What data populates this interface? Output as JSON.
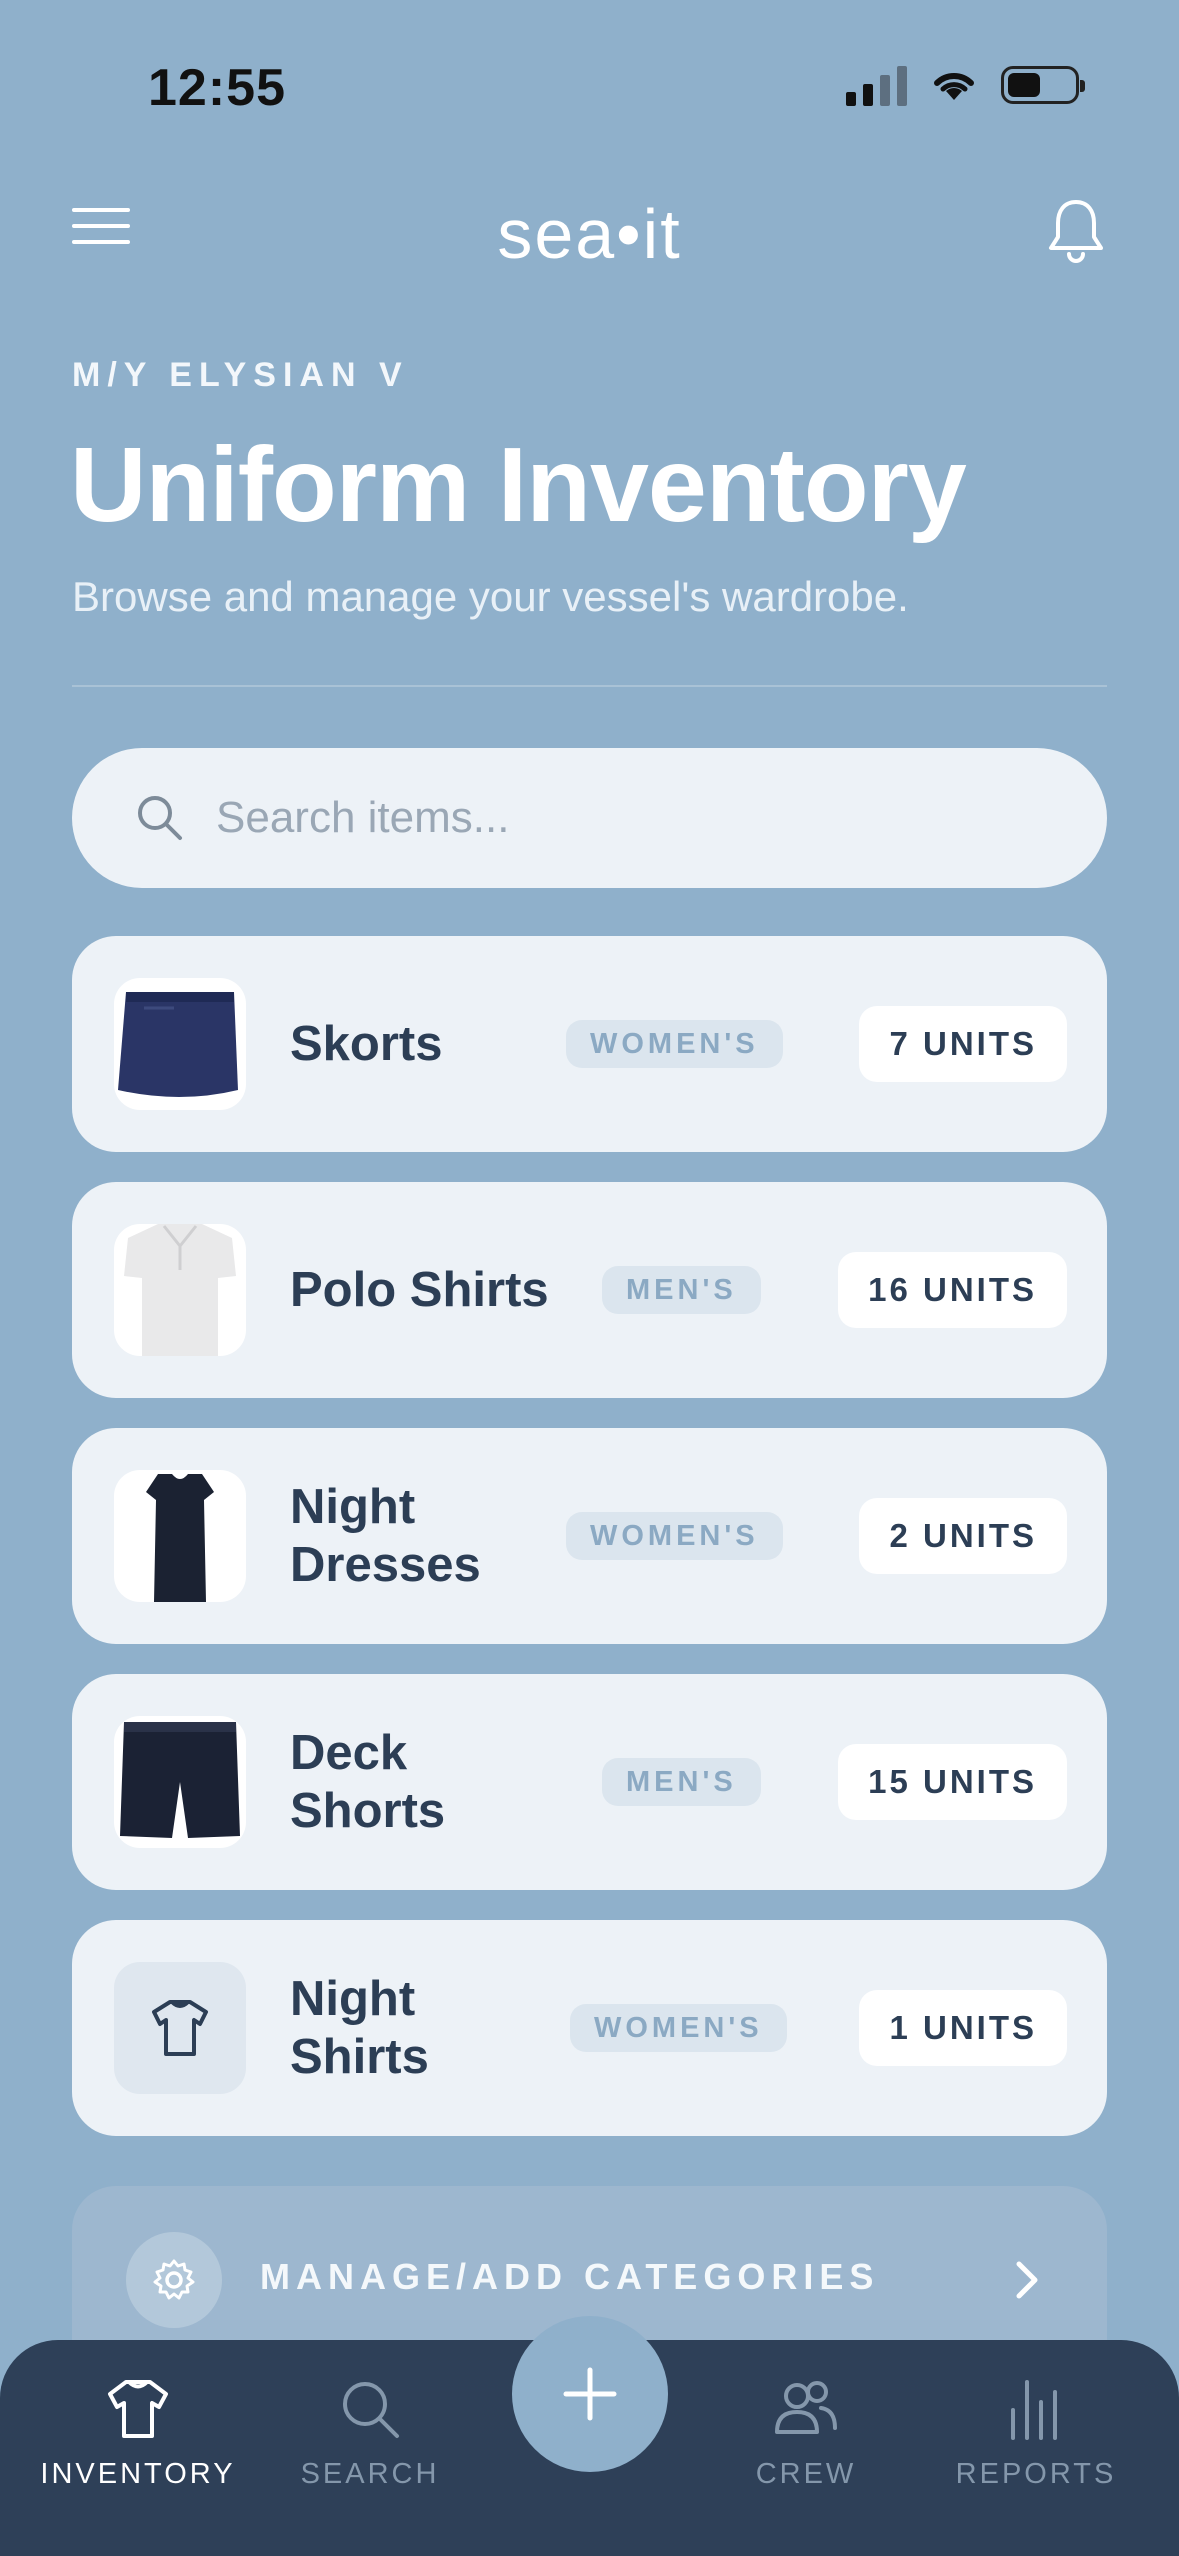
{
  "status_bar": {
    "time": "12:55"
  },
  "header": {
    "brand": "sea•it"
  },
  "page": {
    "vessel": "M/Y ELYSIAN V",
    "title": "Uniform Inventory",
    "subtitle": "Browse and manage your vessel's wardrobe."
  },
  "search": {
    "placeholder": "Search items...",
    "value": ""
  },
  "items": [
    {
      "name": "Skorts",
      "category": "WOMEN'S",
      "units": "7 UNITS",
      "image_icon": "skort-photo"
    },
    {
      "name": "Polo Shirts",
      "category": "MEN'S",
      "units": "16 UNITS",
      "image_icon": "polo-shirt-photo"
    },
    {
      "name": "Night Dresses",
      "category": "WOMEN'S",
      "units": "2 UNITS",
      "image_icon": "dress-photo"
    },
    {
      "name": "Deck Shorts",
      "category": "MEN'S",
      "units": "15 UNITS",
      "image_icon": "shorts-photo"
    },
    {
      "name": "Night Shirts",
      "category": "WOMEN'S",
      "units": "1 UNITS",
      "image_icon": "tshirt-icon"
    }
  ],
  "manage": {
    "label": "MANAGE/ADD CATEGORIES"
  },
  "nav": [
    {
      "label": "INVENTORY",
      "icon": "tshirt-icon",
      "active": true
    },
    {
      "label": "SEARCH",
      "icon": "search-icon",
      "active": false
    },
    {
      "label": "CREW",
      "icon": "users-icon",
      "active": false
    },
    {
      "label": "REPORTS",
      "icon": "bar-chart-icon",
      "active": false
    }
  ],
  "colors": {
    "background": "#8fb0cb",
    "card": "#edf2f7",
    "text_dark": "#2c3e55",
    "nav_bg": "#2e4058",
    "tag_text": "#8ba9c3"
  }
}
